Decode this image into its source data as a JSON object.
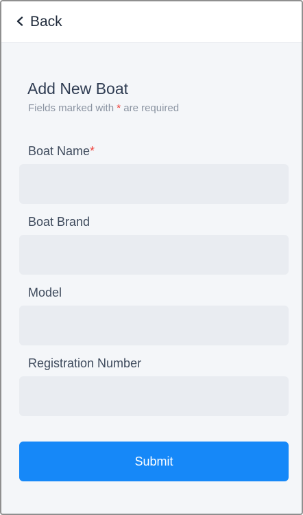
{
  "navigation": {
    "back_label": "Back",
    "back_icon": "chevron-left-icon"
  },
  "form": {
    "title": "Add New Boat",
    "required_note_prefix": "Fields marked with ",
    "required_marker": "*",
    "required_note_suffix": " are required",
    "fields": [
      {
        "label": "Boat Name",
        "required_marker": "*",
        "value": "",
        "placeholder": ""
      },
      {
        "label": "Boat Brand",
        "value": "",
        "placeholder": ""
      },
      {
        "label": "Model",
        "value": "",
        "placeholder": ""
      },
      {
        "label": "Registration Number",
        "value": "",
        "placeholder": ""
      }
    ],
    "submit_label": "Submit"
  },
  "colors": {
    "primary": "#1688F8",
    "required": "#EF3E38",
    "input_background": "#E9ECF1",
    "page_background": "#F4F6F9"
  }
}
